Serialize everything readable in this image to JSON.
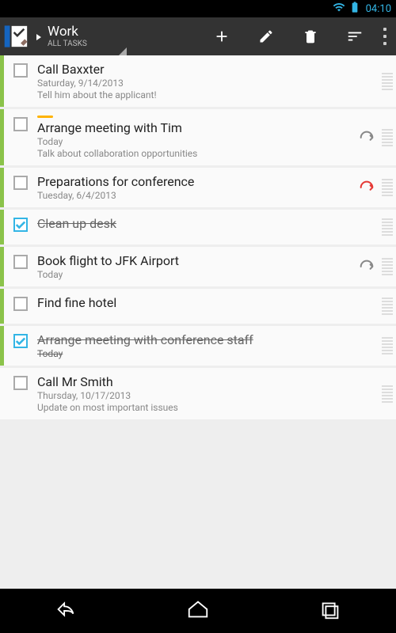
{
  "status": {
    "time": "04:10"
  },
  "header": {
    "title": "Work",
    "subtitle": "ALL TASKS"
  },
  "tasks": [
    {
      "title": "Call Baxxter",
      "date": "Saturday, 9/14/2013",
      "note": "Tell him about the applicant!",
      "checked": false,
      "recurring": false,
      "priority": false
    },
    {
      "title": "Arrange meeting with Tim",
      "date": "Today",
      "note": "Talk about collaboration opportunities",
      "checked": false,
      "recurring": true,
      "priority": true,
      "overdue": false
    },
    {
      "title": "Preparations for conference",
      "date": "Tuesday, 6/4/2013",
      "note": "",
      "checked": false,
      "recurring": true,
      "priority": false,
      "overdue": true
    },
    {
      "title": "Clean up desk",
      "date": "",
      "note": "",
      "checked": true,
      "recurring": false,
      "priority": false
    },
    {
      "title": "Book flight to JFK Airport",
      "date": "Today",
      "note": "",
      "checked": false,
      "recurring": true,
      "priority": false
    },
    {
      "title": "Find fine hotel",
      "date": "",
      "note": "",
      "checked": false,
      "recurring": false,
      "priority": false
    },
    {
      "title": "Arrange meeting with conference staff",
      "date": "Today",
      "note": "",
      "checked": true,
      "recurring": false,
      "priority": false
    },
    {
      "title": "Call Mr Smith",
      "date": "Thursday, 10/17/2013",
      "note": "Update on most important issues",
      "checked": false,
      "recurring": false,
      "priority": false,
      "nostripe": true
    }
  ]
}
